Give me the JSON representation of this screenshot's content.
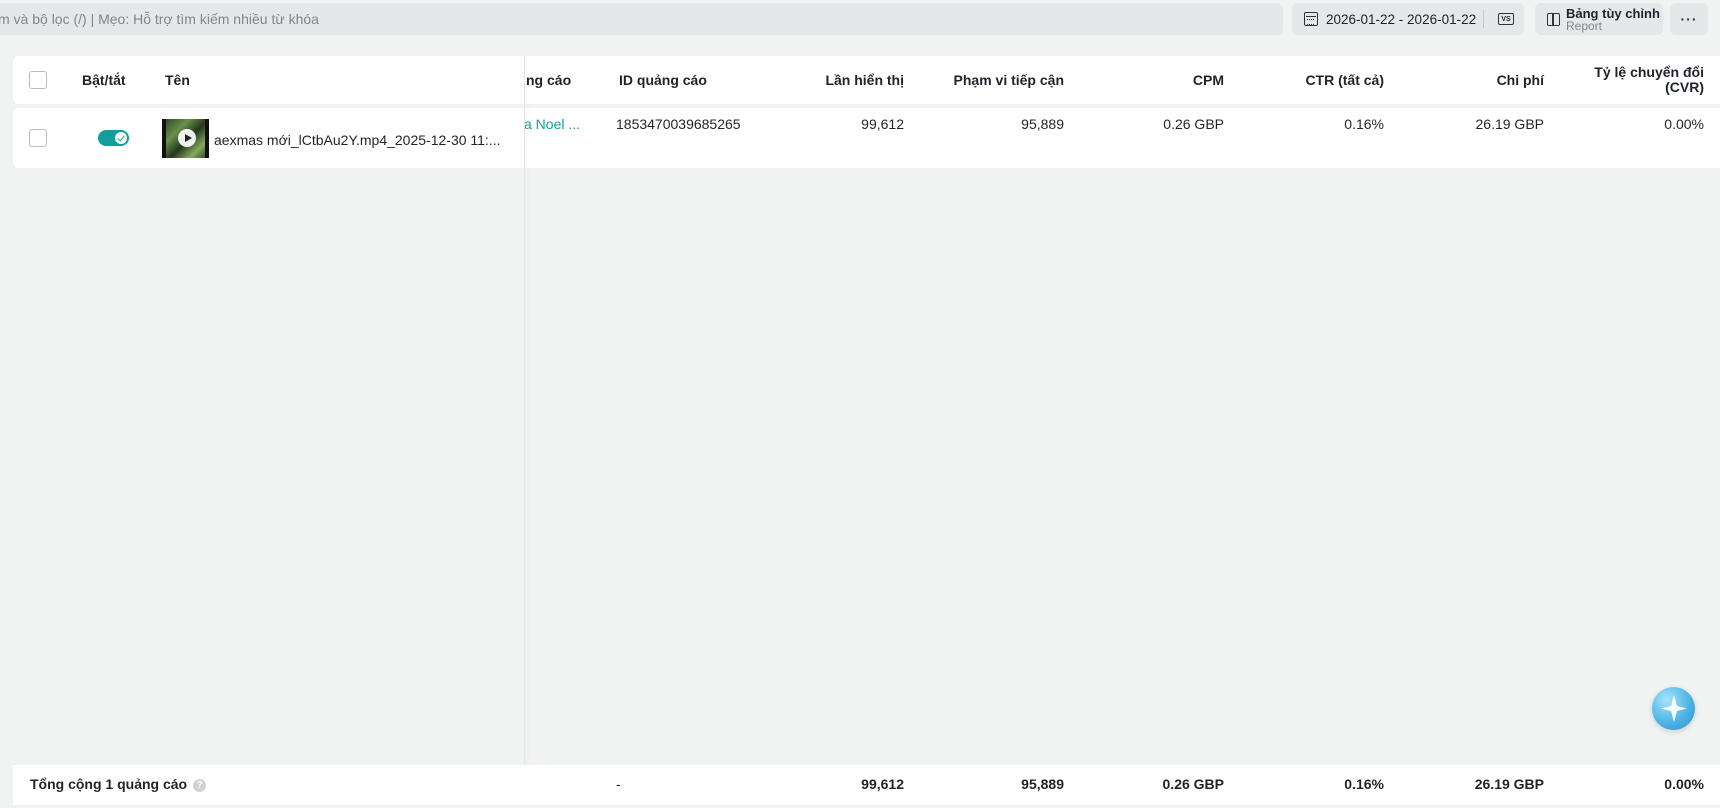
{
  "search": {
    "placeholder": "m và bộ lọc (/) | Mẹo: Hỗ trợ tìm kiếm nhiều từ khóa"
  },
  "date_range": {
    "label": "2026-01-22 - 2026-01-22",
    "compare_icon_text": "VS"
  },
  "custom_table": {
    "title": "Bảng tùy chỉnh",
    "subtitle": "Report"
  },
  "more": {
    "label": "···"
  },
  "table": {
    "headers": {
      "toggle": "Bật/tắt",
      "name": "Tên",
      "ad_group": "ng cáo",
      "ad_id": "ID quảng cáo",
      "impressions": "Lần hiển thị",
      "reach": "Phạm vi tiếp cận",
      "cpm": "CPM",
      "ctr": "CTR (tất cả)",
      "cost": "Chi phí",
      "cvr_line1": "Tỷ lệ chuyển đổi",
      "cvr_line2": "(CVR)"
    },
    "rows": [
      {
        "enabled": true,
        "name": "aexmas mới_lCtbAu2Y.mp4_2025-12-30 11:...",
        "ad_group": "a Noel ...",
        "ad_id": "1853470039685265",
        "impressions": "99,612",
        "reach": "95,889",
        "cpm": "0.26 GBP",
        "ctr": "0.16%",
        "cost": "26.19 GBP",
        "cvr": "0.00%"
      }
    ],
    "footer": {
      "label": "Tổng cộng 1 quảng cáo",
      "help_icon": "?",
      "ad_id": "-",
      "impressions": "99,612",
      "reach": "95,889",
      "cpm": "0.26 GBP",
      "ctr": "0.16%",
      "cost": "26.19 GBP",
      "cvr": "0.00%"
    }
  },
  "colors": {
    "accent": "#139e9e",
    "background": "#f1f2f2"
  }
}
